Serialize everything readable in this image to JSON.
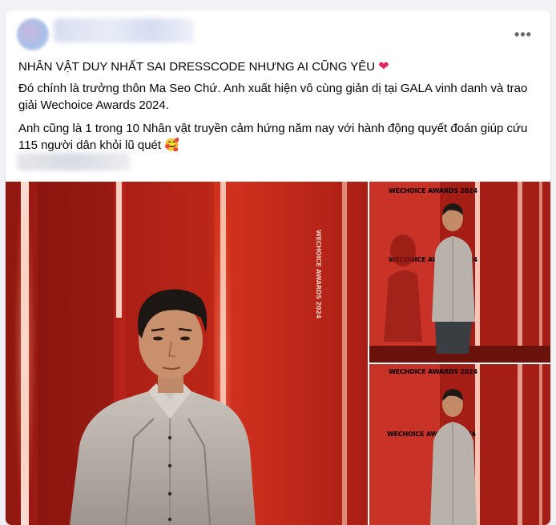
{
  "post": {
    "title": "NHÂN VẬT DUY NHẤT SAI DRESSCODE NHƯNG AI CŨNG YÊU",
    "title_emoji": "❤",
    "paragraph1": "Đó chính là trưởng thôn Ma Seo Chứ. Anh xuất hiện vô cùng giản dị tại GALA vinh danh và trao giải Wechoice Awards 2024.",
    "paragraph2": "Anh cũng là 1 trong 10 Nhân vật truyền cảm hứng năm nay với hành động quyết đoán giúp cứu 115 người dân khỏi lũ quét",
    "paragraph2_emoji": "🥰",
    "more_icon": "•••"
  },
  "photos": {
    "backdrop_brand_1": "WECHOICE AWARDS 2024",
    "backdrop_brand_2": "WECHOICE AWARDS 2024",
    "backdrop_brand_3": "WECHOICE AWARDS 2024",
    "backdrop_brand_4": "WECHOICE AWARDS 2024"
  },
  "colors": {
    "page_bg": "#f0f2f5",
    "card_bg": "#ffffff",
    "text": "#050505",
    "icon_gray": "#65676b",
    "backdrop_red": "#c02b21"
  }
}
